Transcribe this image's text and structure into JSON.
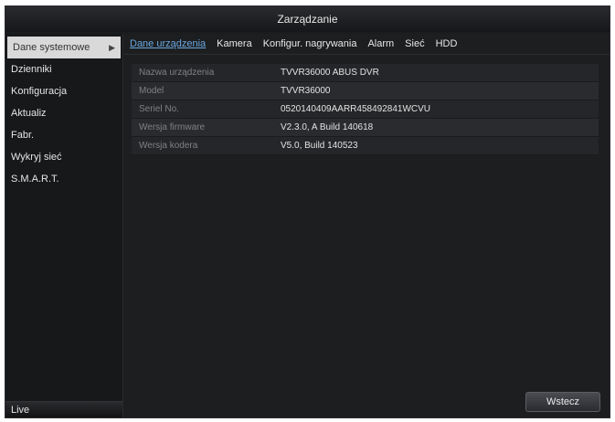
{
  "window": {
    "title": "Zarządzanie"
  },
  "sidebar": {
    "items": [
      {
        "label": "Dane systemowe",
        "active": true
      },
      {
        "label": "Dzienniki"
      },
      {
        "label": "Konfiguracja"
      },
      {
        "label": "Aktualiz"
      },
      {
        "label": "Fabr."
      },
      {
        "label": "Wykryj sieć"
      },
      {
        "label": "S.M.A.R.T."
      }
    ],
    "live_label": "Live"
  },
  "tabs": [
    {
      "label": "Dane urządzenia",
      "active": true
    },
    {
      "label": "Kamera"
    },
    {
      "label": "Konfigur. nagrywania"
    },
    {
      "label": "Alarm"
    },
    {
      "label": "Sieć"
    },
    {
      "label": "HDD"
    }
  ],
  "device_info": [
    {
      "label": "Nazwa urządzenia",
      "value": "TVVR36000 ABUS DVR"
    },
    {
      "label": "Model",
      "value": "TVVR36000"
    },
    {
      "label": "Seriel No.",
      "value": "0520140409AARR458492841WCVU"
    },
    {
      "label": "Wersja firmware",
      "value": "V2.3.0, A Build 140618"
    },
    {
      "label": "Wersja kodera",
      "value": "V5.0, Build 140523"
    }
  ],
  "buttons": {
    "back_label": "Wstecz"
  }
}
